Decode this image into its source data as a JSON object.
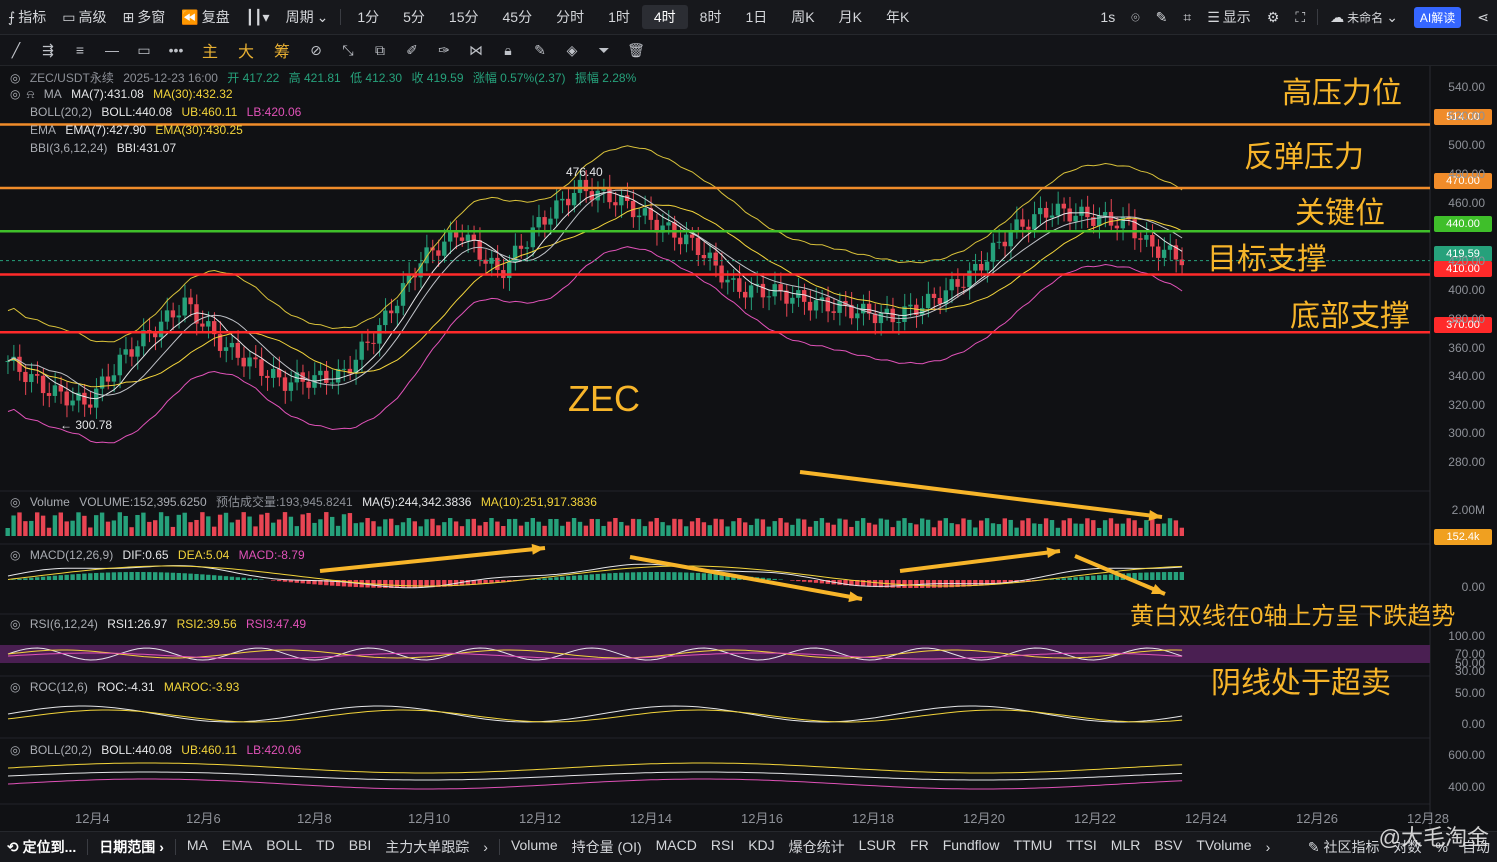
{
  "topbar": {
    "indicators": "指标",
    "advanced": "高级",
    "multi_window": "多窗",
    "replay": "复盘",
    "period": "周期",
    "intervals": [
      "1分",
      "5分",
      "15分",
      "45分",
      "分时",
      "1时",
      "4时",
      "8时",
      "1日",
      "周K",
      "月K",
      "年K"
    ],
    "active_interval": "4时",
    "refresh": "1s",
    "display": "显示",
    "unnamed": "未命名",
    "ai": "AI解读"
  },
  "toolbar2": {
    "labels": [
      "主",
      "大",
      "筹"
    ]
  },
  "legend": {
    "symbol": "ZEC/USDT永续",
    "datetime": "2025-12-23 16:00",
    "open": "开 417.22",
    "high": "高 421.81",
    "low": "低 412.30",
    "close": "收 419.59",
    "change": "涨幅 0.57%(2.37)",
    "amplitude": "振幅 2.28%",
    "ma_name": "MA",
    "ma7": "MA(7):431.08",
    "ma30": "MA(30):432.32",
    "boll_name": "BOLL(20,2)",
    "boll": "BOLL:440.08",
    "ub": "UB:460.11",
    "lb": "LB:420.06",
    "ema_name": "EMA",
    "ema7": "EMA(7):427.90",
    "ema30": "EMA(30):430.25",
    "bbi_name": "BBI(3,6,12,24)",
    "bbi": "BBI:431.07",
    "high_mark": "476.40",
    "low_mark": "300.78"
  },
  "volume_legend": {
    "name": "Volume",
    "volume": "VOLUME:152,395.6250",
    "est": "预估成交量:193,945.8241",
    "ma5": "MA(5):244,342.3836",
    "ma10": "MA(10):251,917.3836"
  },
  "macd_legend": {
    "name": "MACD(12,26,9)",
    "dif": "DIF:0.65",
    "dea": "DEA:5.04",
    "macd": "MACD:-8.79"
  },
  "rsi_legend": {
    "name": "RSI(6,12,24)",
    "rsi1": "RSI1:26.97",
    "rsi2": "RSI2:39.56",
    "rsi3": "RSI3:47.49"
  },
  "roc_legend": {
    "name": "ROC(12,6)",
    "roc": "ROC:-4.31",
    "maroc": "MAROC:-3.93"
  },
  "boll2_legend": {
    "name": "BOLL(20,2)",
    "boll": "BOLL:440.08",
    "ub": "UB:460.11",
    "lb": "LB:420.06"
  },
  "annotations": {
    "high_pressure": "高压力位",
    "rebound_pressure": "反弹压力",
    "key_level": "关键位",
    "target_support": "目标支撑",
    "bottom_support": "底部支撑",
    "coin": "ZEC",
    "macd_note": "黄白双线在0轴上方呈下跌趋势",
    "rsi_note": "阴线处于超卖"
  },
  "price_levels": {
    "l514": "514.00",
    "l470": "470.00",
    "l440": "440.00",
    "current": "419.59",
    "l410": "410.00",
    "l370": "370.00",
    "vol_current": "152.4k"
  },
  "price_axis": [
    "540.00",
    "520.00",
    "500.00",
    "480.00",
    "460.00",
    "420.00",
    "400.00",
    "380.00",
    "360.00",
    "340.00",
    "320.00",
    "300.00",
    "280.00"
  ],
  "vol_axis": [
    "2.00M"
  ],
  "macd_axis": [
    "0.00"
  ],
  "rsi_axis": [
    "100.00",
    "70.00",
    "50.00",
    "30.00"
  ],
  "roc_axis": [
    "50.00",
    "0.00"
  ],
  "boll_axis": [
    "600.00",
    "400.00"
  ],
  "dates": [
    "12月4",
    "12月6",
    "12月8",
    "12月10",
    "12月12",
    "12月14",
    "12月16",
    "12月18",
    "12月20",
    "12月22",
    "12月24",
    "12月26",
    "12月28"
  ],
  "bottombar": {
    "locate": "定位到...",
    "date_range": "日期范围",
    "main_indicators": [
      "MA",
      "EMA",
      "BOLL",
      "TD",
      "BBI",
      "主力大单跟踪"
    ],
    "sub_indicators": [
      "Volume",
      "持仓量 (OI)",
      "MACD",
      "RSI",
      "KDJ",
      "爆仓统计",
      "LSUR",
      "FR",
      "Fundflow",
      "TTMU",
      "TTSI",
      "MLR",
      "BSV",
      "TVolume"
    ],
    "right": [
      "社区指标",
      "对数",
      "%",
      "自动"
    ]
  },
  "watermark": "@大毛淘金",
  "colors": {
    "up": "#26a17b",
    "down": "#e84553",
    "orange": "#f08c2a",
    "green": "#3fbf2a",
    "red": "#ff2a2a",
    "accent": "#f7b52a"
  }
}
